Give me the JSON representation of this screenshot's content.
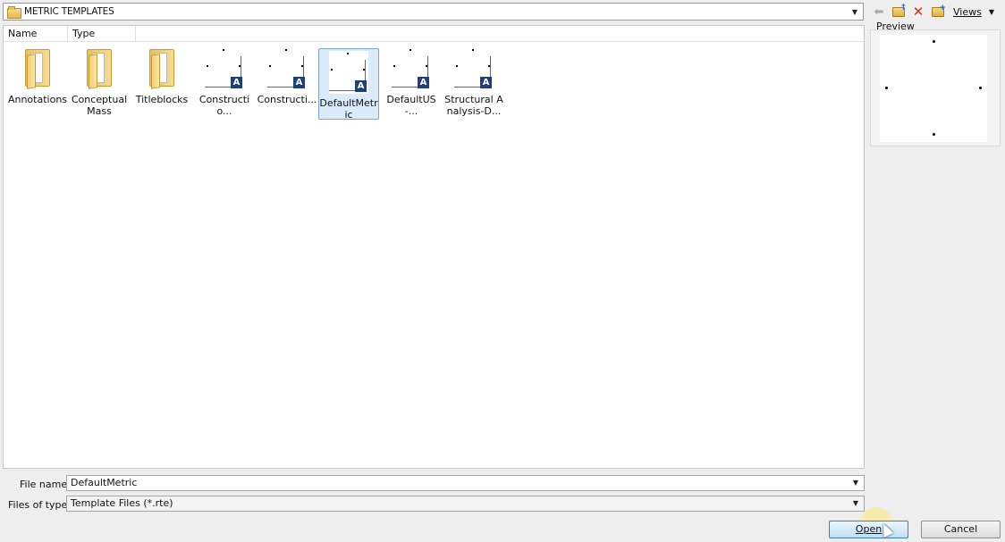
{
  "location": {
    "path": "METRIC TEMPLATES"
  },
  "toolbar": {
    "views_label": "Views"
  },
  "columns": [
    "Name",
    "Type"
  ],
  "items": [
    {
      "label": "Annotations",
      "kind": "folder"
    },
    {
      "label": "Conceptual Mass",
      "kind": "folder"
    },
    {
      "label": "Titleblocks",
      "kind": "folder"
    },
    {
      "label": "Constructio...",
      "kind": "template"
    },
    {
      "label": "Constructi...",
      "kind": "template"
    },
    {
      "label": "DefaultMetric",
      "kind": "template",
      "selected": true
    },
    {
      "label": "DefaultUS-...",
      "kind": "template"
    },
    {
      "label": "Structural Analysis-D...",
      "kind": "template"
    }
  ],
  "preview": {
    "label": "Preview"
  },
  "file_name": {
    "label": "File name:",
    "value": "DefaultMetric"
  },
  "file_type": {
    "label": "Files of type:",
    "value": "Template Files  (*.rte)"
  },
  "buttons": {
    "open": "Open",
    "cancel": "Cancel"
  },
  "colors": {
    "selection": "#dcebfc",
    "selection_border": "#7da2ce",
    "primary_button": "#bfe0f5"
  }
}
